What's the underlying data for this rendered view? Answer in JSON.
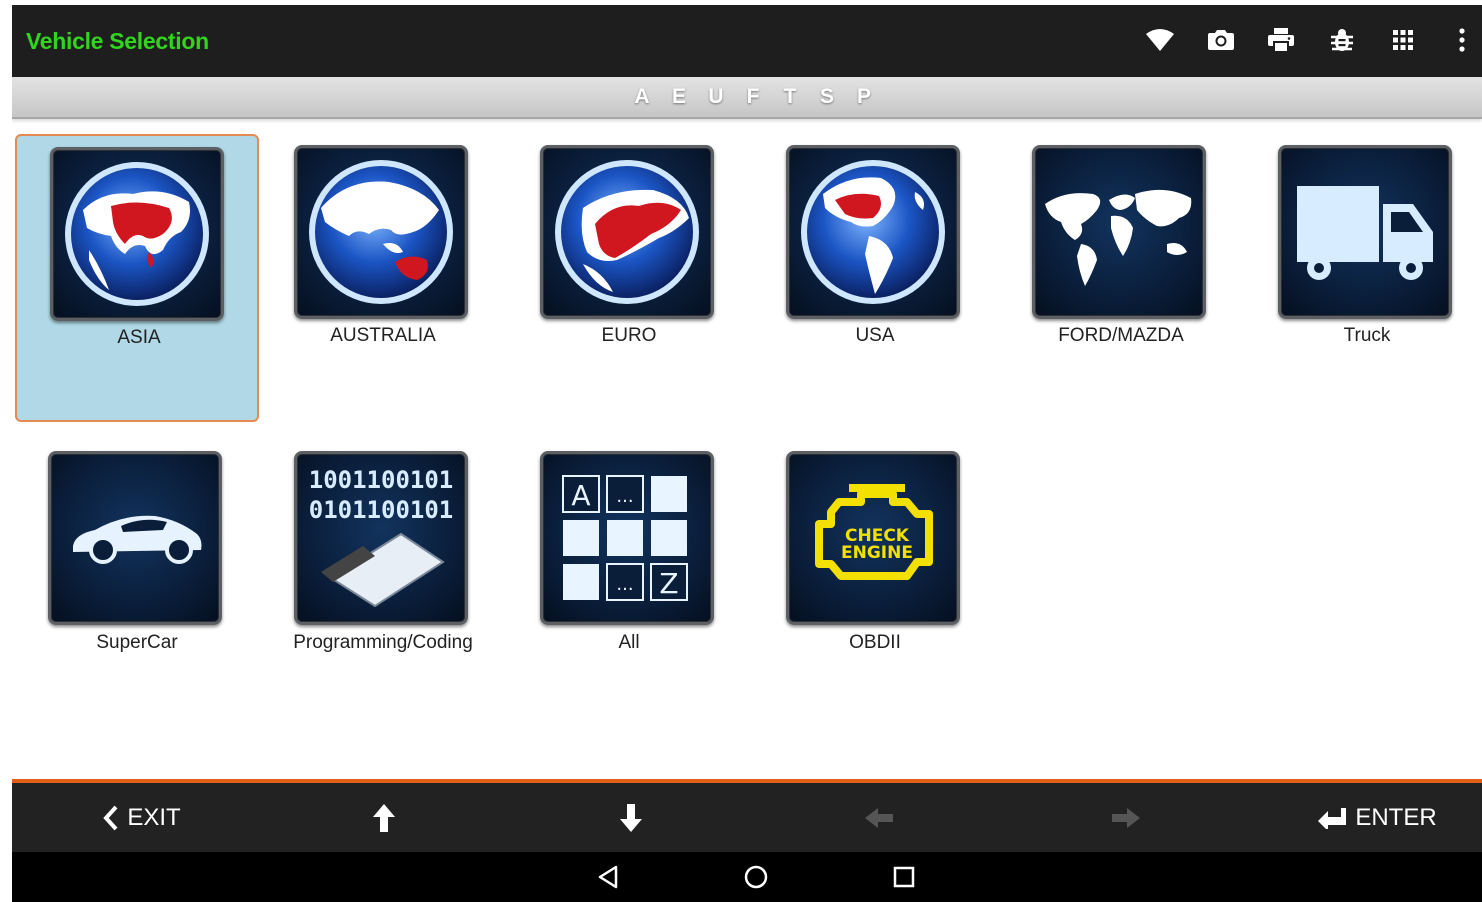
{
  "header": {
    "title": "Vehicle Selection",
    "title_color": "#31d51f",
    "icons": [
      "wifi-icon",
      "camera-icon",
      "printer-icon",
      "bug-icon",
      "apps-grid-icon",
      "more-vert-icon"
    ]
  },
  "alpha_index": {
    "letters": [
      "A",
      "E",
      "U",
      "F",
      "T",
      "S",
      "P"
    ]
  },
  "tiles": [
    {
      "label": "ASIA",
      "icon": "globe-asia-icon",
      "selected": true
    },
    {
      "label": "AUSTRALIA",
      "icon": "globe-australia-icon",
      "selected": false
    },
    {
      "label": "EURO",
      "icon": "globe-europe-icon",
      "selected": false
    },
    {
      "label": "USA",
      "icon": "globe-usa-icon",
      "selected": false
    },
    {
      "label": "FORD/MAZDA",
      "icon": "world-map-icon",
      "selected": false
    },
    {
      "label": "Truck",
      "icon": "truck-icon",
      "selected": false
    },
    {
      "label": "SuperCar",
      "icon": "sportscar-icon",
      "selected": false
    },
    {
      "label": "Programming/Coding",
      "icon": "ecu-binary-icon",
      "selected": false
    },
    {
      "label": "All",
      "icon": "alphabet-grid-icon",
      "selected": false
    },
    {
      "label": "OBDII",
      "icon": "check-engine-icon",
      "selected": false
    }
  ],
  "programming_icon_text": {
    "line1": "1001100101",
    "line2": "0101100101"
  },
  "all_icon_text": {
    "first": "A",
    "mid1": "...",
    "mid2": "...",
    "last": "Z"
  },
  "obd_icon_text": {
    "line1": "CHECK",
    "line2": "ENGINE"
  },
  "footer": {
    "exit_label": "EXIT",
    "enter_label": "ENTER",
    "up_icon": "arrow-up-icon",
    "down_icon": "arrow-down-icon",
    "left_icon": "arrow-left-icon",
    "right_icon": "arrow-right-icon",
    "accent_color": "#e0601a"
  },
  "system_nav": [
    "back-icon",
    "home-icon",
    "recents-icon"
  ]
}
